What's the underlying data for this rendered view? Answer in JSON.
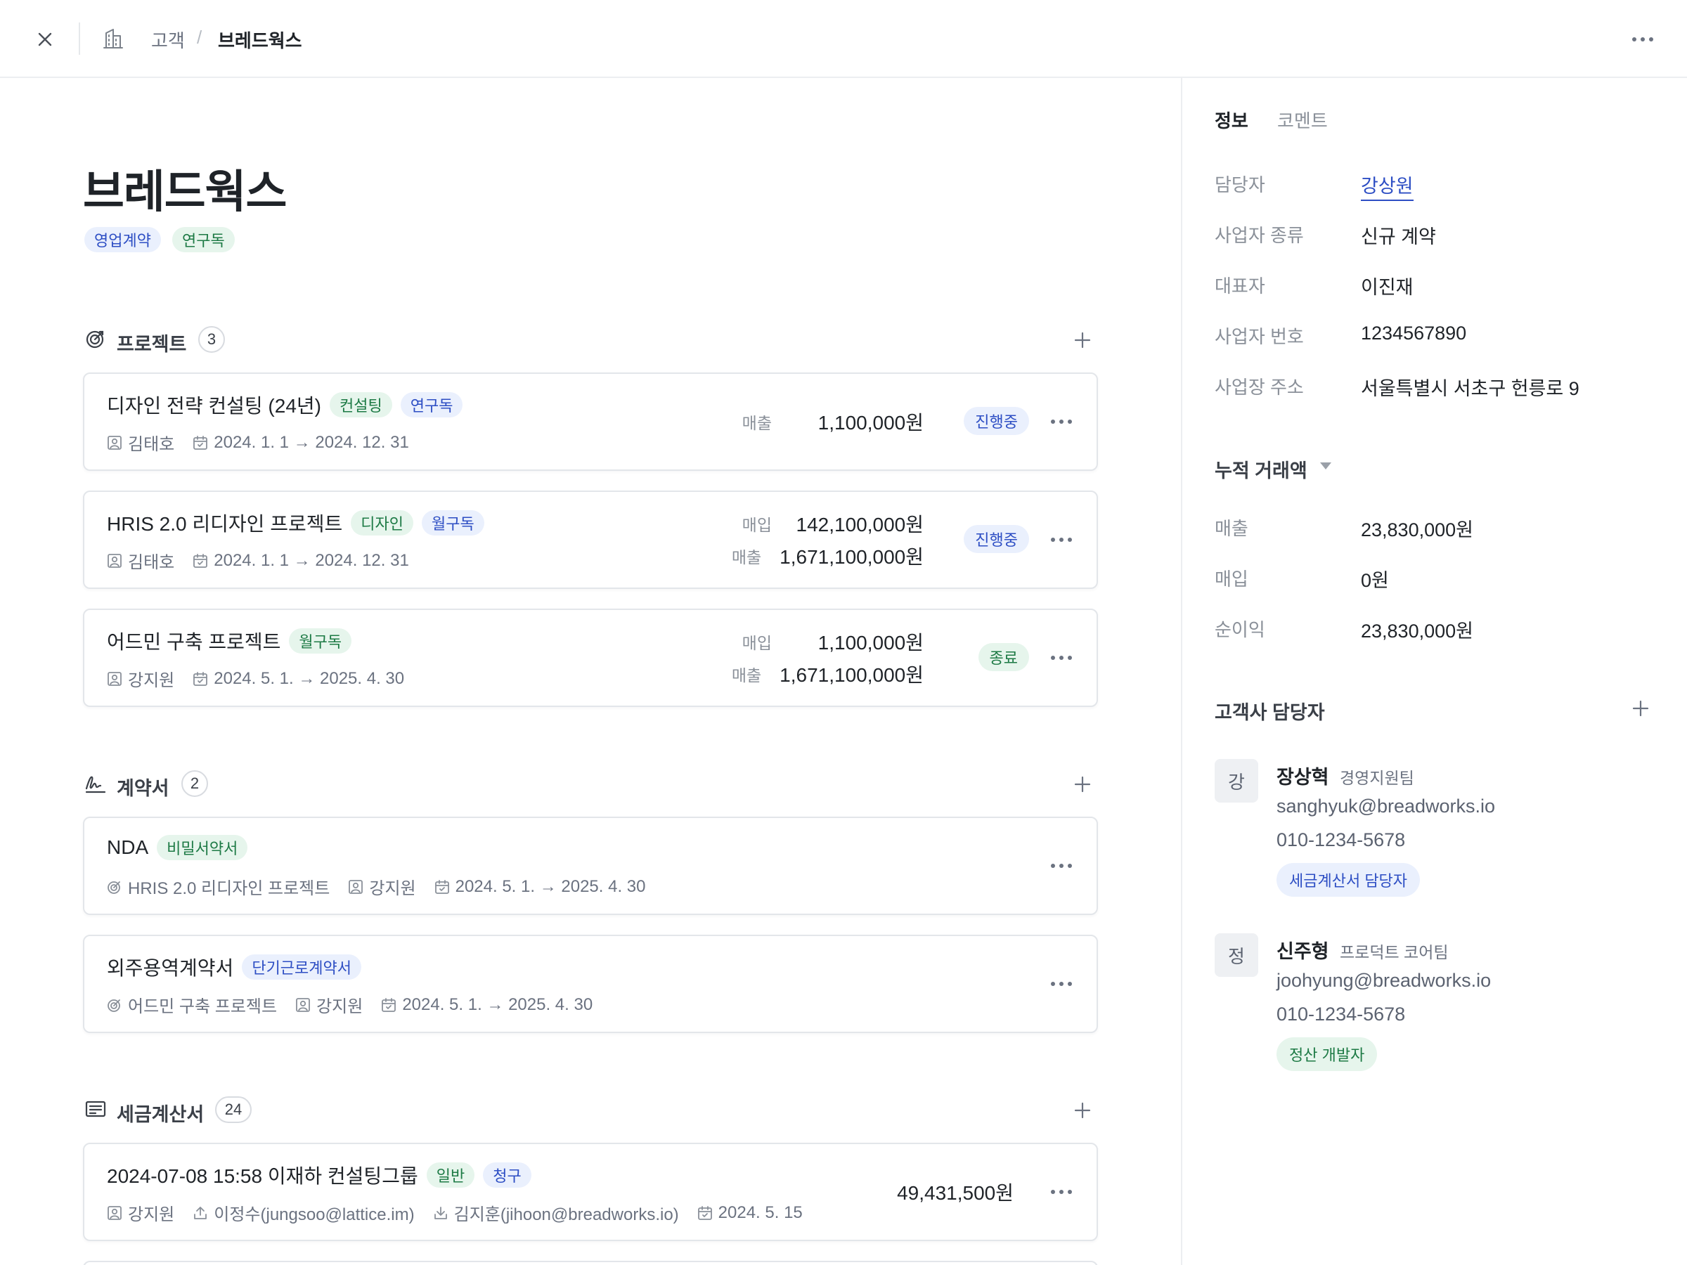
{
  "breadcrumb": {
    "parent": "고객",
    "separator": "/",
    "current": "브레드웍스"
  },
  "company": {
    "title": "브레드웍스",
    "tags": [
      "영업계약",
      "연구독"
    ]
  },
  "sections": {
    "projects": {
      "title": "프로젝트",
      "count": "3"
    },
    "contracts": {
      "title": "계약서",
      "count": "2"
    },
    "invoices": {
      "title": "세금계산서",
      "count": "24"
    }
  },
  "projects": [
    {
      "title": "디자인 전략 컨설팅 (24년)",
      "tags": [
        "컨설팅",
        "연구독"
      ],
      "owner": "김태호",
      "period": "2024. 1. 1 → 2024. 12. 31",
      "amounts": [
        {
          "label": "매출",
          "value": "1,100,000원"
        }
      ],
      "status": "진행중"
    },
    {
      "title": "HRIS 2.0 리디자인 프로젝트",
      "tags": [
        "디자인",
        "월구독"
      ],
      "owner": "김태호",
      "period": "2024. 1. 1 → 2024. 12. 31",
      "amounts": [
        {
          "label": "매입",
          "value": "142,100,000원"
        },
        {
          "label": "매출",
          "value": "1,671,100,000원"
        }
      ],
      "status": "진행중"
    },
    {
      "title": "어드민 구축 프로젝트",
      "tags": [
        "월구독"
      ],
      "owner": "강지원",
      "period": "2024. 5. 1. → 2025. 4. 30",
      "amounts": [
        {
          "label": "매입",
          "value": "1,100,000원"
        },
        {
          "label": "매출",
          "value": "1,671,100,000원"
        }
      ],
      "status": "종료"
    }
  ],
  "contracts": [
    {
      "title": "NDA",
      "tag": "비밀서약서",
      "project": "HRIS 2.0 리디자인 프로젝트",
      "owner": "강지원",
      "period": "2024. 5. 1. → 2025. 4. 30"
    },
    {
      "title": "외주용역계약서",
      "tag": "단기근로계약서",
      "project": "어드민 구축 프로젝트",
      "owner": "강지원",
      "period": "2024. 5. 1. → 2025. 4. 30"
    }
  ],
  "invoices": [
    {
      "title": "2024-07-08 15:58 이재하 컨설팅그룹",
      "tags": [
        "일반",
        "청구"
      ],
      "owner": "강지원",
      "sender": "이정수(jungsoo@lattice.im)",
      "receiver": "김지훈(jihoon@breadworks.io)",
      "date": "2024. 5. 15",
      "amount": "49,431,500원"
    }
  ],
  "panel": {
    "tabs": [
      "정보",
      "코멘트"
    ],
    "info": [
      {
        "label": "담당자",
        "value": "강상원"
      },
      {
        "label": "사업자 종류",
        "value": "신규 계약"
      },
      {
        "label": "대표자",
        "value": "이진재"
      },
      {
        "label": "사업자 번호",
        "value": "1234567890"
      },
      {
        "label": "사업장 주소",
        "value": "서울특별시 서초구 헌릉로 9"
      }
    ],
    "totals_title": "누적 거래액",
    "totals": [
      {
        "label": "매출",
        "value": "23,830,000원"
      },
      {
        "label": "매입",
        "value": "0원"
      },
      {
        "label": "순이익",
        "value": "23,830,000원"
      }
    ],
    "contacts_title": "고객사 담당자",
    "contacts": [
      {
        "initial": "강",
        "name": "장상혁",
        "team": "경영지원팀",
        "email": "sanghyuk@breadworks.io",
        "phone": "010-1234-5678",
        "role": "세금계산서 담당자"
      },
      {
        "initial": "정",
        "name": "신주형",
        "team": "프로덕트 코어팀",
        "email": "joohyung@breadworks.io",
        "phone": "010-1234-5678",
        "role": "정산 개발자"
      }
    ]
  },
  "colors": {
    "accent_blue": "#2d4ec4",
    "chip_blue_bg": "#eaf0fd",
    "accent_green": "#1d7a45",
    "chip_green_bg": "#e6f5ec",
    "border": "#e3e6ea"
  },
  "icons": {
    "close": "close-icon",
    "building": "building-icon",
    "more": "more-icon",
    "projects": "target-icon",
    "contracts": "signature-icon",
    "invoices": "receipt-icon",
    "add": "plus-icon",
    "person": "person-icon",
    "calendar": "calendar-icon",
    "upload": "upload-icon",
    "download": "download-icon",
    "caret": "caret-down-icon"
  }
}
